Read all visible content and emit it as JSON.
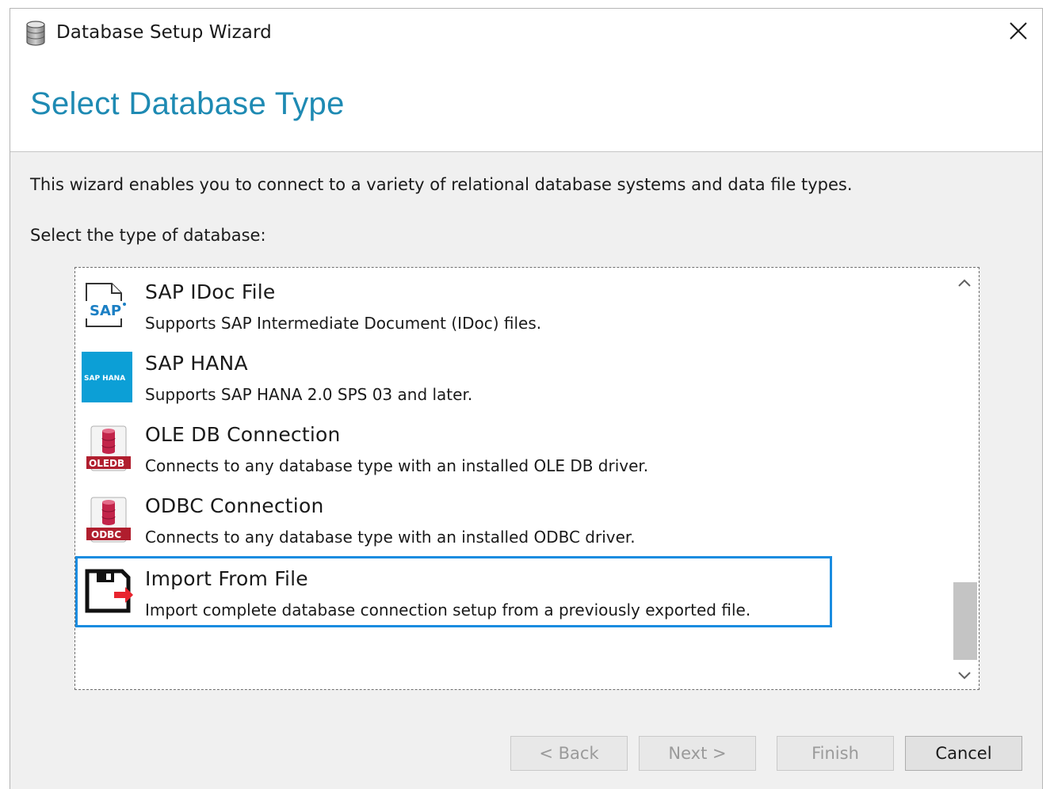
{
  "window": {
    "title": "Database Setup Wizard",
    "app_icon": "database-icon",
    "close_icon": "close-icon"
  },
  "header": {
    "page_title": "Select Database Type",
    "accent_color": "#1e8ab3"
  },
  "body": {
    "intro": "This wizard enables you to connect to a variety of relational database systems and data file types.",
    "select_label": "Select the type of database:"
  },
  "database_types": [
    {
      "title": "SAP IDoc File",
      "description": "Supports SAP Intermediate Document (IDoc) files.",
      "icon": "sap-file-icon",
      "icon_text": "SAP",
      "selected": false
    },
    {
      "title": "SAP HANA",
      "description": "Supports SAP HANA 2.0 SPS 03 and later.",
      "icon": "sap-hana-icon",
      "icon_text": "SAP HANA",
      "selected": false
    },
    {
      "title": "OLE DB Connection",
      "description": "Connects to any database type with an installed OLE DB driver.",
      "icon": "oledb-icon",
      "icon_text": "OLEDB",
      "selected": false
    },
    {
      "title": "ODBC Connection",
      "description": "Connects to any database type with an installed ODBC driver.",
      "icon": "odbc-icon",
      "icon_text": "ODBC",
      "selected": false
    },
    {
      "title": "Import From File",
      "description": "Import complete database connection setup from a previously exported file.",
      "icon": "import-file-icon",
      "selected": true
    }
  ],
  "list": {
    "selection_color": "#1a8ce0",
    "scroll_up_icon": "chevron-up-icon",
    "scroll_down_icon": "chevron-down-icon"
  },
  "buttons": {
    "back": "< Back",
    "next": "Next >",
    "finish": "Finish",
    "cancel": "Cancel"
  }
}
